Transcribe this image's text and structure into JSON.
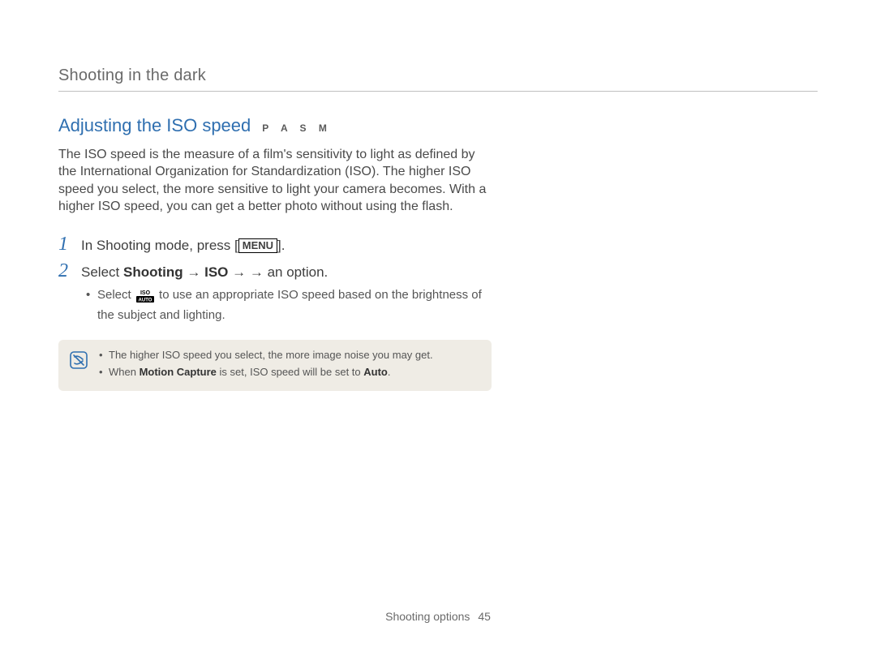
{
  "chapter_title": "Shooting in the dark",
  "section": {
    "title": "Adjusting the ISO speed",
    "modes": "P A S M",
    "body": "The ISO speed is the measure of a film's sensitivity to light as defined by the International Organization for Standardization (ISO). The higher ISO speed you select, the more sensitive to light your camera becomes. With a higher ISO speed, you can get a better photo without using the flash."
  },
  "steps": [
    {
      "num": "1",
      "prefix": "In Shooting mode, press [",
      "menu_label": "MENU",
      "suffix": "]."
    },
    {
      "num": "2",
      "parts": {
        "a": "Select ",
        "b1": "Shooting",
        "arrow": " → ",
        "b2": "ISO",
        "c": " → an option."
      }
    }
  ],
  "sub_bullet": {
    "a": "Select ",
    "b": " to use an appropriate ISO speed based on the brightness of the subject and lighting."
  },
  "note": {
    "items": [
      {
        "text": "The higher ISO speed you select, the more image noise you may get."
      },
      {
        "a": "When ",
        "b1": "Motion Capture",
        "mid": " is set, ISO speed will be set to ",
        "b2": "Auto",
        "end": "."
      }
    ]
  },
  "footer": {
    "section": "Shooting options",
    "page": "45"
  }
}
